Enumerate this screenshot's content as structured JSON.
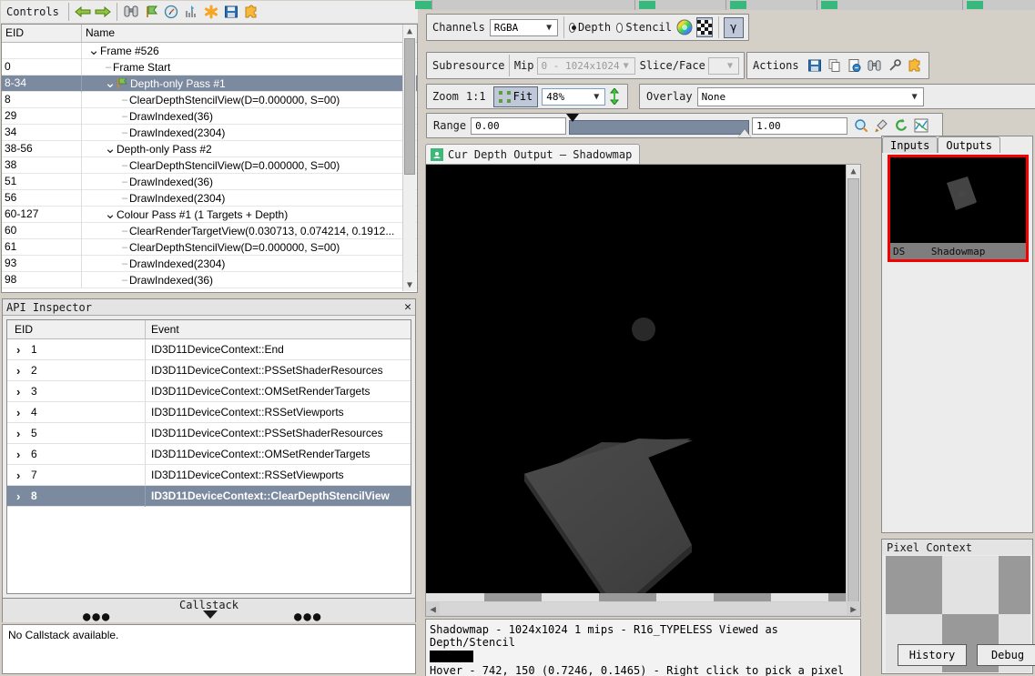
{
  "event_browser": {
    "controls_label": "Controls",
    "toolbar_icons": [
      "back-arrow-icon",
      "forward-arrow-icon",
      "binoculars-icon",
      "flag-icon",
      "timer-icon",
      "bar-chart-icon",
      "asterisk-icon",
      "save-icon",
      "puzzle-icon"
    ],
    "columns": [
      "EID",
      "Name"
    ],
    "rows": [
      {
        "eid": "",
        "name": "Frame #526",
        "indent": 0,
        "chevron": "v",
        "flag": false,
        "selected": false
      },
      {
        "eid": "0",
        "name": "Frame Start",
        "indent": 1,
        "chevron": "",
        "flag": false,
        "selected": false
      },
      {
        "eid": "8-34",
        "name": "Depth-only Pass #1",
        "indent": 1,
        "chevron": "v",
        "flag": true,
        "selected": true
      },
      {
        "eid": "8",
        "name": "ClearDepthStencilView(D=0.000000, S=00)",
        "indent": 2,
        "chevron": "",
        "flag": false,
        "selected": false
      },
      {
        "eid": "29",
        "name": "DrawIndexed(36)",
        "indent": 2,
        "chevron": "",
        "flag": false,
        "selected": false
      },
      {
        "eid": "34",
        "name": "DrawIndexed(2304)",
        "indent": 2,
        "chevron": "",
        "flag": false,
        "selected": false
      },
      {
        "eid": "38-56",
        "name": "Depth-only Pass #2",
        "indent": 1,
        "chevron": "v",
        "flag": false,
        "selected": false
      },
      {
        "eid": "38",
        "name": "ClearDepthStencilView(D=0.000000, S=00)",
        "indent": 2,
        "chevron": "",
        "flag": false,
        "selected": false
      },
      {
        "eid": "51",
        "name": "DrawIndexed(36)",
        "indent": 2,
        "chevron": "",
        "flag": false,
        "selected": false
      },
      {
        "eid": "56",
        "name": "DrawIndexed(2304)",
        "indent": 2,
        "chevron": "",
        "flag": false,
        "selected": false
      },
      {
        "eid": "60-127",
        "name": "Colour Pass #1 (1 Targets + Depth)",
        "indent": 1,
        "chevron": "v",
        "flag": false,
        "selected": false
      },
      {
        "eid": "60",
        "name": "ClearRenderTargetView(0.030713, 0.074214, 0.1912...",
        "indent": 2,
        "chevron": "",
        "flag": false,
        "selected": false
      },
      {
        "eid": "61",
        "name": "ClearDepthStencilView(D=0.000000, S=00)",
        "indent": 2,
        "chevron": "",
        "flag": false,
        "selected": false
      },
      {
        "eid": "93",
        "name": "DrawIndexed(2304)",
        "indent": 2,
        "chevron": "",
        "flag": false,
        "selected": false
      },
      {
        "eid": "98",
        "name": "DrawIndexed(36)",
        "indent": 2,
        "chevron": "",
        "flag": false,
        "selected": false
      }
    ]
  },
  "api_inspector": {
    "title": "API Inspector",
    "close_label": "✕",
    "columns": [
      "EID",
      "Event"
    ],
    "rows": [
      {
        "eid": "1",
        "event": "ID3D11DeviceContext::End",
        "selected": false
      },
      {
        "eid": "2",
        "event": "ID3D11DeviceContext::PSSetShaderResources",
        "selected": false
      },
      {
        "eid": "3",
        "event": "ID3D11DeviceContext::OMSetRenderTargets",
        "selected": false
      },
      {
        "eid": "4",
        "event": "ID3D11DeviceContext::RSSetViewports",
        "selected": false
      },
      {
        "eid": "5",
        "event": "ID3D11DeviceContext::PSSetShaderResources",
        "selected": false
      },
      {
        "eid": "6",
        "event": "ID3D11DeviceContext::OMSetRenderTargets",
        "selected": false
      },
      {
        "eid": "7",
        "event": "ID3D11DeviceContext::RSSetViewports",
        "selected": false
      },
      {
        "eid": "8",
        "event": "ID3D11DeviceContext::ClearDepthStencilView",
        "selected": true
      }
    ]
  },
  "callstack": {
    "title": "Callstack",
    "left_dots": "●●●",
    "right_dots": "●●●",
    "body": "No Callstack available."
  },
  "texture_viewer": {
    "channels": {
      "label": "Channels",
      "value": "RGBA",
      "depth_label": "Depth",
      "depth_selected": true,
      "stencil_label": "Stencil",
      "stencil_selected": false,
      "colorwheel_icon": "color-wheel-icon",
      "checkerboard_icon": "checkerboard-icon",
      "gamma_label": "γ"
    },
    "subresource": {
      "label": "Subresource",
      "mip_label": "Mip",
      "mip_value": "0 - 1024x1024",
      "slice_label": "Slice/Face",
      "slice_value": ""
    },
    "actions": {
      "label": "Actions",
      "icons": [
        "save-texture-icon",
        "copy-icon",
        "open-in-icon",
        "binoculars-icon",
        "pin-icon",
        "puzzle-icon"
      ]
    },
    "zoom": {
      "label": "Zoom",
      "one_to_one": "1:1",
      "fit_label": "Fit",
      "fit_active": true,
      "percent": "48%",
      "flip_icon": "flip-y-icon"
    },
    "overlay": {
      "label": "Overlay",
      "value": "None"
    },
    "range": {
      "label": "Range",
      "min": "0.00",
      "max": "1.00",
      "icons": [
        "magnifier-icon",
        "eyedropper-icon",
        "reset-icon",
        "autofit-icon"
      ]
    },
    "tab": {
      "label": "Cur Depth Output – Shadowmap",
      "icon": "texture-tab-icon"
    },
    "status": {
      "resource_line": "Shadowmap - 1024x1024 1 mips - R16_TYPELESS Viewed as Depth/Stencil",
      "hover_line": "Hover -  742,  150 (0.7246, 0.1465) - Right click to pick a pixel",
      "swatch_color": "#000000"
    }
  },
  "io_panel": {
    "tabs": [
      {
        "label": "Inputs",
        "active": false
      },
      {
        "label": "Outputs",
        "active": true
      }
    ],
    "thumbnail": {
      "slot": "DS",
      "name": "Shadowmap",
      "highlight_color": "#f40000"
    }
  },
  "pixel_context": {
    "title": "Pixel Context",
    "history_label": "History",
    "debug_label": "Debug"
  },
  "colors": {
    "selection": "#7c8aa0",
    "window_bg": "#d4d0c8",
    "panel_bg": "#ececec",
    "tab_green": "#37b87c",
    "flag_green": "#6db33f"
  }
}
